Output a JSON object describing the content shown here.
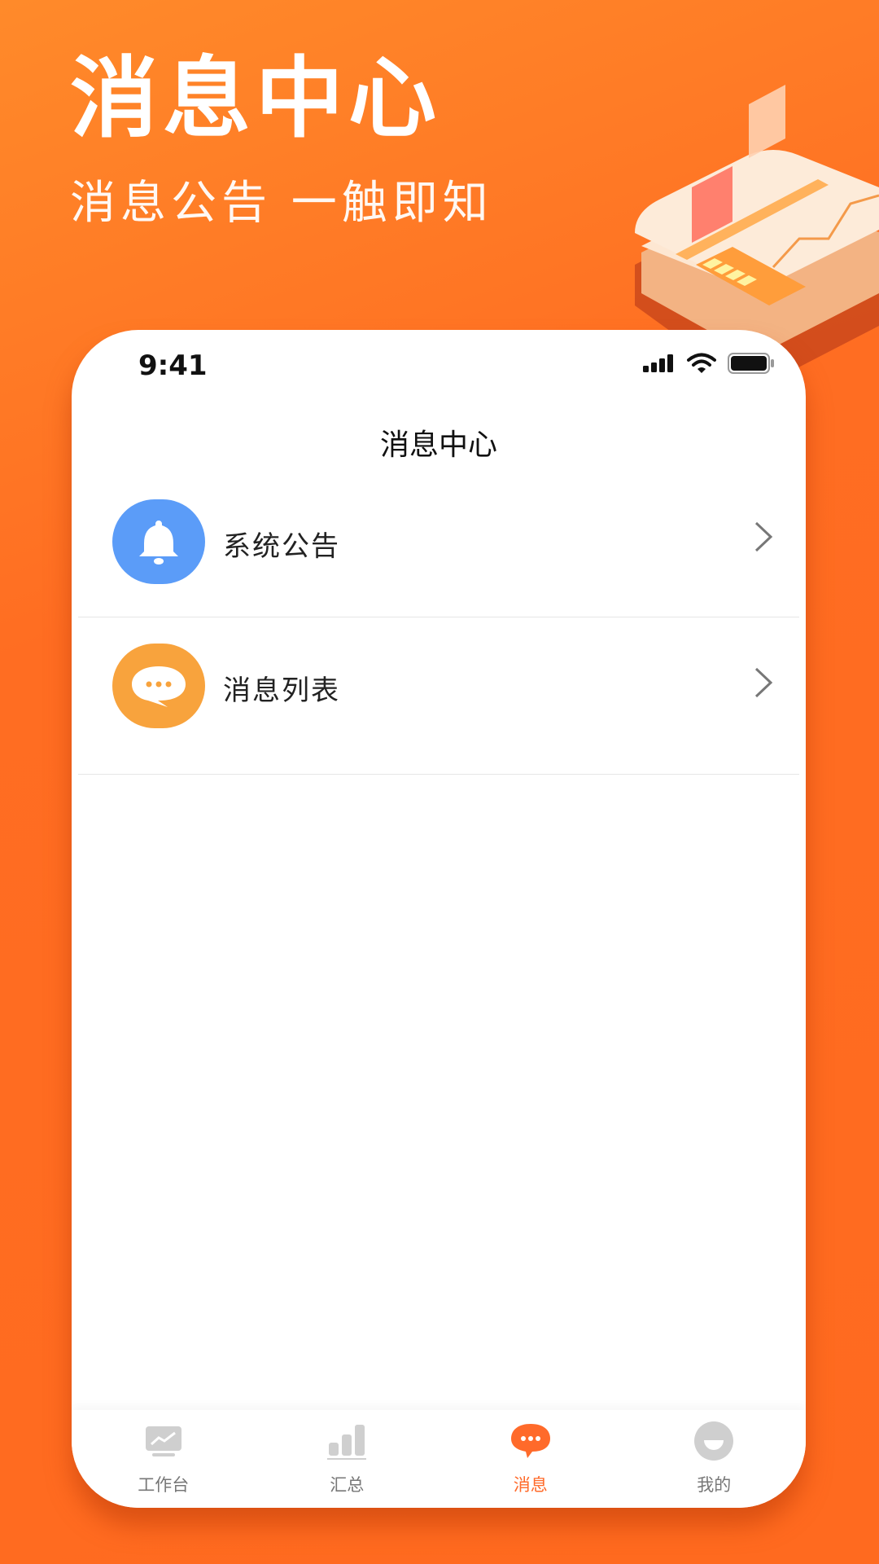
{
  "hero": {
    "title": "消息中心",
    "subtitle": "消息公告 一触即知"
  },
  "status_bar": {
    "time": "9:41"
  },
  "page_title": "消息中心",
  "list_items": [
    {
      "label": "系统公告",
      "icon": "bell-icon",
      "icon_bg": "#5b9cf8"
    },
    {
      "label": "消息列表",
      "icon": "chat-bubble-icon",
      "icon_bg": "#f8a33d"
    }
  ],
  "tabbar": [
    {
      "label": "工作台",
      "icon": "dashboard-icon",
      "active": false
    },
    {
      "label": "汇总",
      "icon": "bar-chart-icon",
      "active": false
    },
    {
      "label": "消息",
      "icon": "message-icon",
      "active": true
    },
    {
      "label": "我的",
      "icon": "profile-icon",
      "active": false
    }
  ],
  "colors": {
    "brand_orange": "#ff6d22",
    "active_tab": "#ff6a2a",
    "bell_bg": "#5b9cf8",
    "chat_bg": "#f8a33d"
  }
}
